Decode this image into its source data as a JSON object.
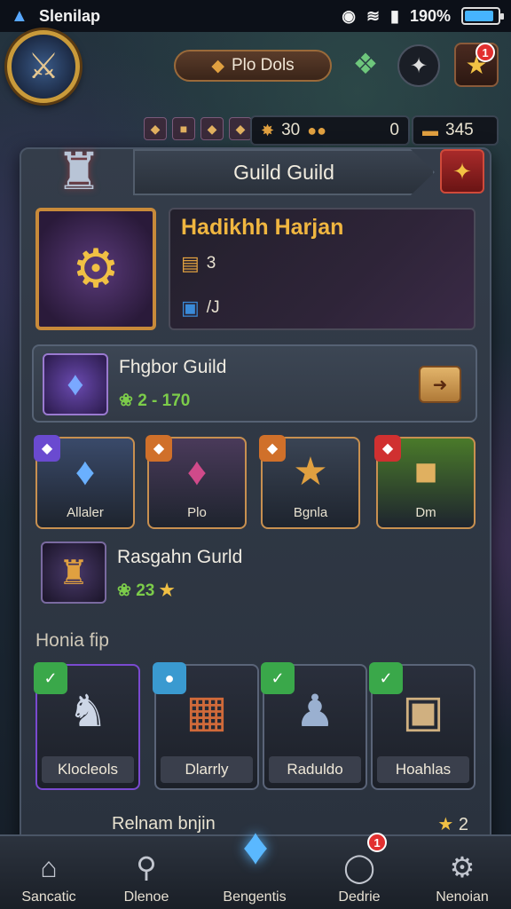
{
  "status_bar": {
    "carrier": "Slenilap",
    "battery_text": "190%",
    "battery_level": 0.9
  },
  "header": {
    "player_name": "Plo Dols",
    "notification_count": "1"
  },
  "currency": {
    "gold": "30",
    "keys": "0",
    "bars": "345"
  },
  "guild_panel": {
    "title": "Guild Guild",
    "guild_name": "Hadikhh Harjan",
    "stat_chests": "3",
    "stat_cards": "/J"
  },
  "fighter_guild": {
    "title": "Fhgbor Guild",
    "stat": "2 - 170"
  },
  "tiles": [
    {
      "label": "Allaler",
      "corner_color": "#6a4ad0",
      "bg": "#3a4a6a"
    },
    {
      "label": "Plo",
      "corner_color": "#d0702a",
      "bg": "#4a3a5a"
    },
    {
      "label": "Bgnla",
      "corner_color": "#d0702a",
      "bg": "#3a4454"
    },
    {
      "label": "Dm",
      "corner_color": "#d03030",
      "bg": "#4a7a2a"
    }
  ],
  "rasgahn_guild": {
    "title": "Rasgahn Gurld",
    "stat": "23"
  },
  "section": {
    "label": "Honia fip"
  },
  "heroes": [
    {
      "name": "Klocleols",
      "tag_color": "#3aa84a",
      "border": "#7a4ad0"
    },
    {
      "name": "Dlarrly",
      "tag_color": "#3a9ad0",
      "border": "#5a6478"
    },
    {
      "name": "Raduldo",
      "tag_color": "#3aa84a",
      "border": "#5a6478"
    },
    {
      "name": "Hoahlas",
      "tag_color": "#3aa84a",
      "border": "#5a6478"
    }
  ],
  "partial_row": {
    "title": "Relnam bnjin",
    "right": "2"
  },
  "nav": {
    "items": [
      "Sancatic",
      "Dlenoe",
      "Bengentis",
      "Dedrie",
      "Nenoian"
    ],
    "badge": "1"
  }
}
